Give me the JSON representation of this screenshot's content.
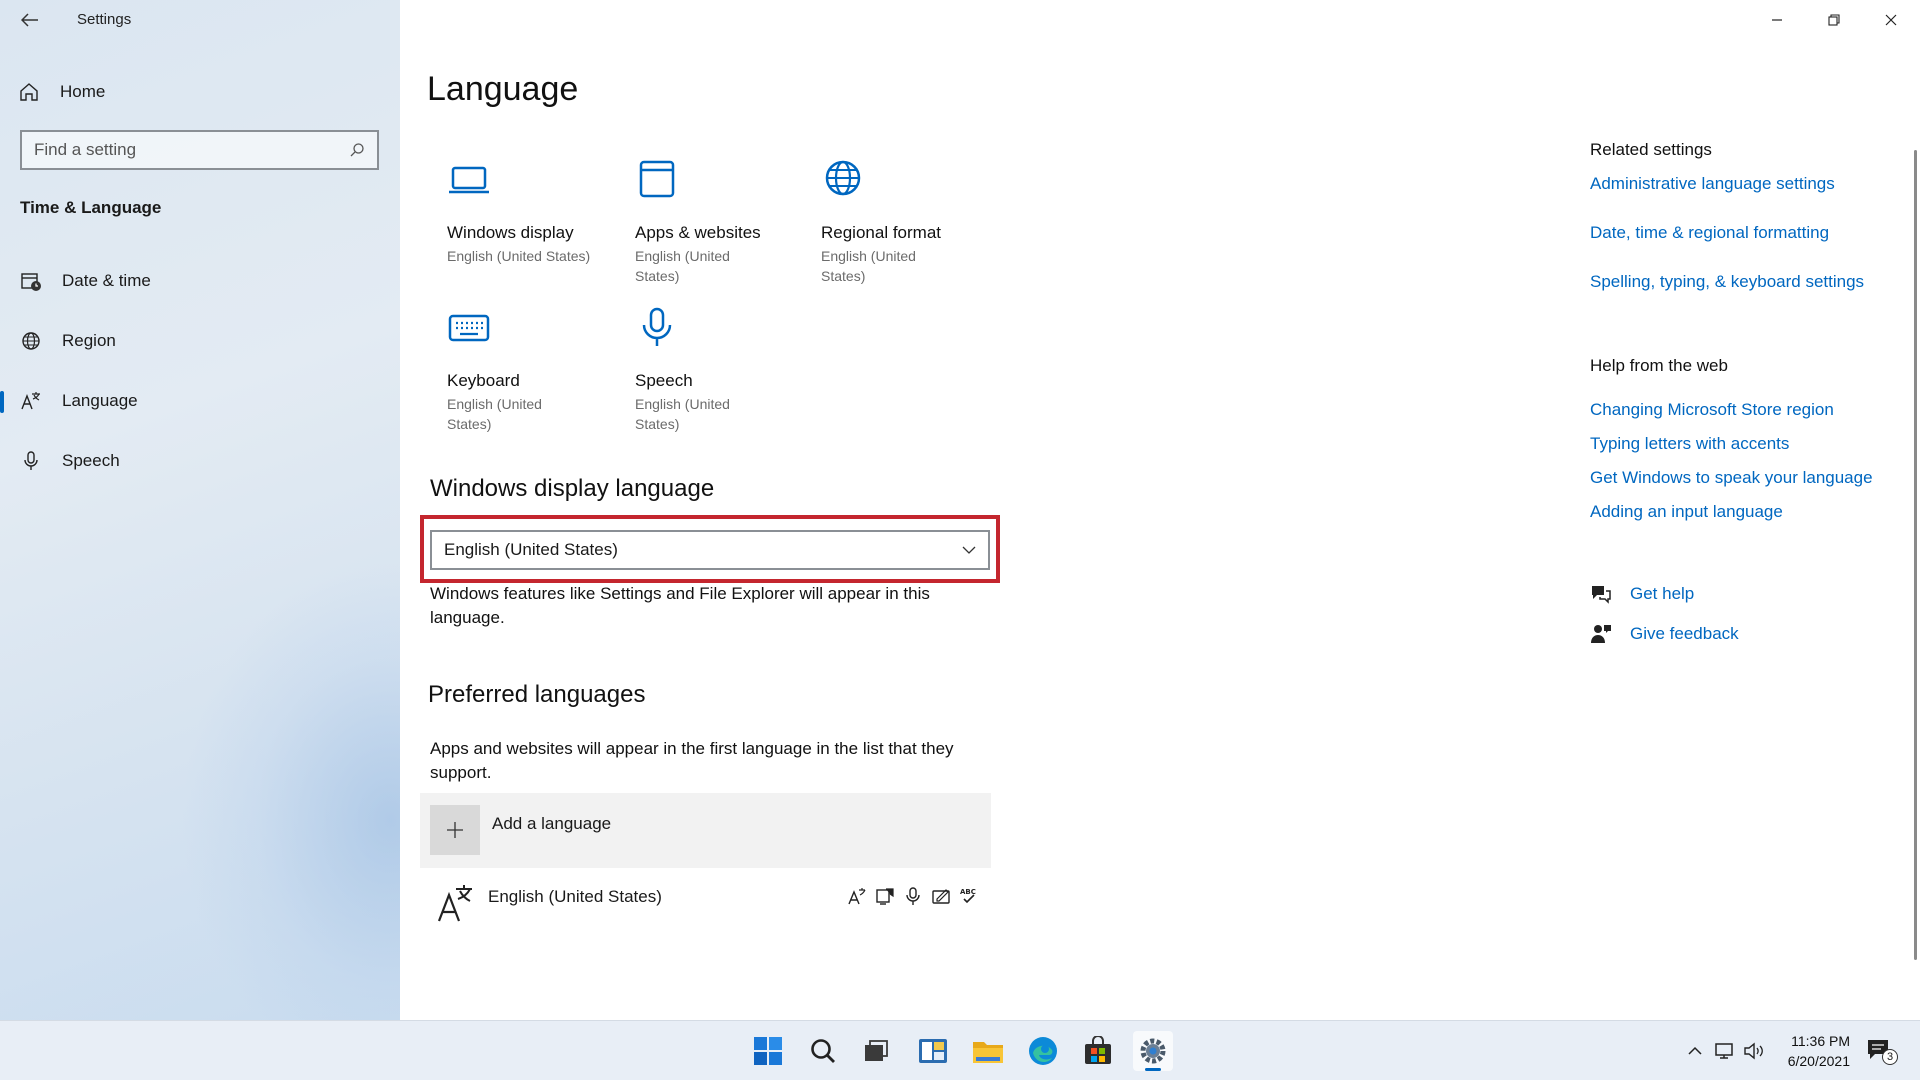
{
  "window": {
    "title": "Settings"
  },
  "sidebar": {
    "home_label": "Home",
    "search_placeholder": "Find a setting",
    "section_label": "Time & Language",
    "items": [
      {
        "label": "Date & time",
        "icon": "calendar-clock-icon",
        "selected": false
      },
      {
        "label": "Region",
        "icon": "globe-icon",
        "selected": false
      },
      {
        "label": "Language",
        "icon": "language-icon",
        "selected": true
      },
      {
        "label": "Speech",
        "icon": "microphone-icon",
        "selected": false
      }
    ]
  },
  "main": {
    "title": "Language",
    "tiles": [
      {
        "title": "Windows display",
        "subtitle": "English (United States)",
        "icon": "laptop-icon"
      },
      {
        "title": "Apps & websites",
        "subtitle": "English (United States)",
        "icon": "window-icon"
      },
      {
        "title": "Regional format",
        "subtitle": "English (United States)",
        "icon": "globe-icon"
      },
      {
        "title": "Keyboard",
        "subtitle": "English (United States)",
        "icon": "keyboard-icon"
      },
      {
        "title": "Speech",
        "subtitle": "English (United States)",
        "icon": "microphone-icon"
      }
    ],
    "display_language": {
      "heading": "Windows display language",
      "selected_value": "English (United States)",
      "description": "Windows features like Settings and File Explorer will appear in this language."
    },
    "preferred": {
      "heading": "Preferred languages",
      "description": "Apps and websites will appear in the first language in the list that they support.",
      "add_label": "Add a language",
      "languages": [
        {
          "name": "English (United States)",
          "features": [
            "display-language-icon",
            "text-to-speech-icon",
            "speech-recognition-icon",
            "handwriting-icon",
            "spell-check-icon"
          ]
        }
      ]
    }
  },
  "related": {
    "heading": "Related settings",
    "links": [
      "Administrative language settings",
      "Date, time & regional formatting",
      "Spelling, typing, & keyboard settings"
    ]
  },
  "help_web": {
    "heading": "Help from the web",
    "links": [
      "Changing Microsoft Store region",
      "Typing letters with accents",
      "Get Windows to speak your language",
      "Adding an input language"
    ]
  },
  "support": {
    "get_help": "Get help",
    "give_feedback": "Give feedback"
  },
  "taskbar": {
    "time": "11:36 PM",
    "date": "6/20/2021",
    "notification_count": "3",
    "apps": [
      "start-icon",
      "search-icon",
      "task-view-icon",
      "widgets-icon",
      "file-explorer-icon",
      "edge-icon",
      "store-icon",
      "settings-icon"
    ]
  },
  "colors": {
    "accent": "#0067c0",
    "highlight": "#c4262e"
  }
}
